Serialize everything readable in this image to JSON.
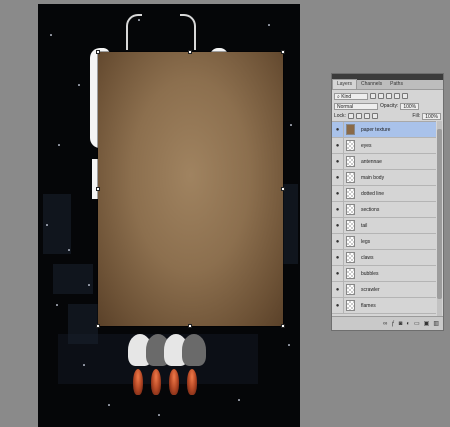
{
  "panel": {
    "tabs": [
      "Layers",
      "Channels",
      "Paths"
    ],
    "filter_kind": "Kind",
    "blend_mode": "Normal",
    "opacity_label": "Opacity:",
    "opacity_value": "100%",
    "lock_label": "Lock:",
    "fill_label": "Fill:",
    "fill_value": "100%",
    "layers": [
      {
        "name": "paper texture",
        "selected": true
      },
      {
        "name": "eyes",
        "selected": false
      },
      {
        "name": "antennae",
        "selected": false
      },
      {
        "name": "main body",
        "selected": false
      },
      {
        "name": "dotted line",
        "selected": false
      },
      {
        "name": "sections",
        "selected": false
      },
      {
        "name": "tail",
        "selected": false
      },
      {
        "name": "legs",
        "selected": false
      },
      {
        "name": "claws",
        "selected": false
      },
      {
        "name": "bubbles",
        "selected": false
      },
      {
        "name": "scrawler",
        "selected": false
      },
      {
        "name": "flames",
        "selected": false
      }
    ],
    "bottom_icons": [
      "link-icon",
      "fx-icon",
      "mask-icon",
      "adjustment-icon",
      "folder-icon",
      "new-layer-icon",
      "trash-icon"
    ]
  },
  "colors": {
    "workspace": "#8a8a8a",
    "canvas_bg": "#050608",
    "paper": "#8c6f4e",
    "selected_layer": "#a9c2ea"
  }
}
